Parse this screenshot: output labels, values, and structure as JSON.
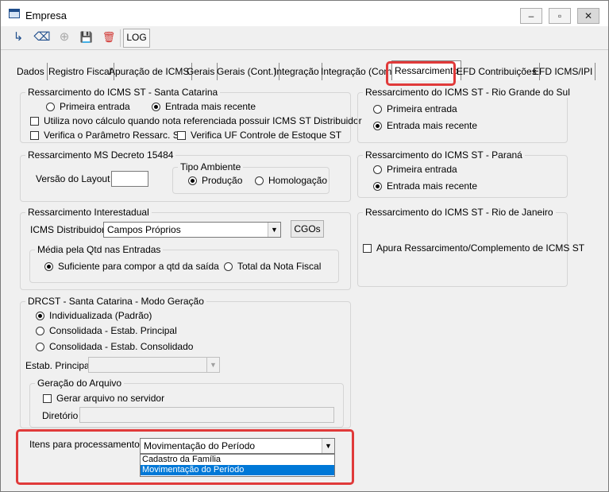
{
  "window": {
    "title": "Empresa"
  },
  "titlebar": {
    "minimize": "–",
    "restore": "▫",
    "close": "✕"
  },
  "toolbar": {
    "exit_icon": "↳",
    "clear_icon": "⌫",
    "add_icon": "⊕",
    "save_icon": "💾",
    "delete_icon": "🗑",
    "log_label": "LOG"
  },
  "tabs": [
    "Dados",
    "Registro Fiscal",
    "Apuração de ICMS",
    "Gerais",
    "Gerais (Cont.)",
    "Integração",
    "Integração (Com.",
    "Ressarcimento",
    "EFD Contribuições",
    "EFD ICMS/IPI"
  ],
  "sc_group": {
    "title": "Ressarcimento do ICMS ST - Santa Catarina",
    "primeira": "Primeira entrada",
    "recente": "Entrada mais recente",
    "chk_novo_calculo": "Utiliza novo cálculo quando nota referenciada possuir ICMS ST Distribuidor",
    "chk_verifica_param": "Verifica o Parâmetro Ressarc. ST",
    "chk_verifica_uf": "Verifica UF Controle de Estoque ST"
  },
  "rs_group": {
    "title": "Ressarcimento do ICMS ST - Rio Grande do Sul",
    "primeira": "Primeira entrada",
    "recente": "Entrada mais recente"
  },
  "ms_group": {
    "title": "Ressarcimento MS Decreto 15484",
    "versao_label": "Versão do Layout",
    "tipo_title": "Tipo Ambiente",
    "producao": "Produção",
    "homologacao": "Homologação"
  },
  "pr_group": {
    "title": "Ressarcimento do ICMS ST - Paraná",
    "primeira": "Primeira entrada",
    "recente": "Entrada mais recente"
  },
  "inter_group": {
    "title": "Ressarcimento Interestadual",
    "distribuidor_label": "ICMS Distribuidor:",
    "distribuidor_value": "Campos Próprios",
    "cgos_button": "CGOs",
    "media_title": "Média pela Qtd nas Entradas",
    "suficiente": "Suficiente para compor a qtd da saída",
    "total_nota": "Total da Nota Fiscal"
  },
  "rj_group": {
    "title": "Ressarcimento do ICMS ST - Rio de Janeiro",
    "chk_apura": "Apura Ressarcimento/Complemento de ICMS ST"
  },
  "drcst_group": {
    "title": "DRCST - Santa Catarina - Modo Geração",
    "individualizada": "Individualizada (Padrão)",
    "consol_principal": "Consolidada - Estab. Principal",
    "consol_consolidado": "Consolidada - Estab. Consolidado",
    "estab_label": "Estab. Principal",
    "geracao_title": "Geração do Arquivo",
    "chk_gerar": "Gerar arquivo no servidor",
    "diretorio_label": "Diretório"
  },
  "itens": {
    "label": "Itens para processamento",
    "selected": "Movimentação do Período",
    "options": [
      "Cadastro da Família",
      "Movimentação do Período"
    ]
  },
  "colors": {
    "highlight": "#e03a3a",
    "selection": "#0078d7"
  }
}
